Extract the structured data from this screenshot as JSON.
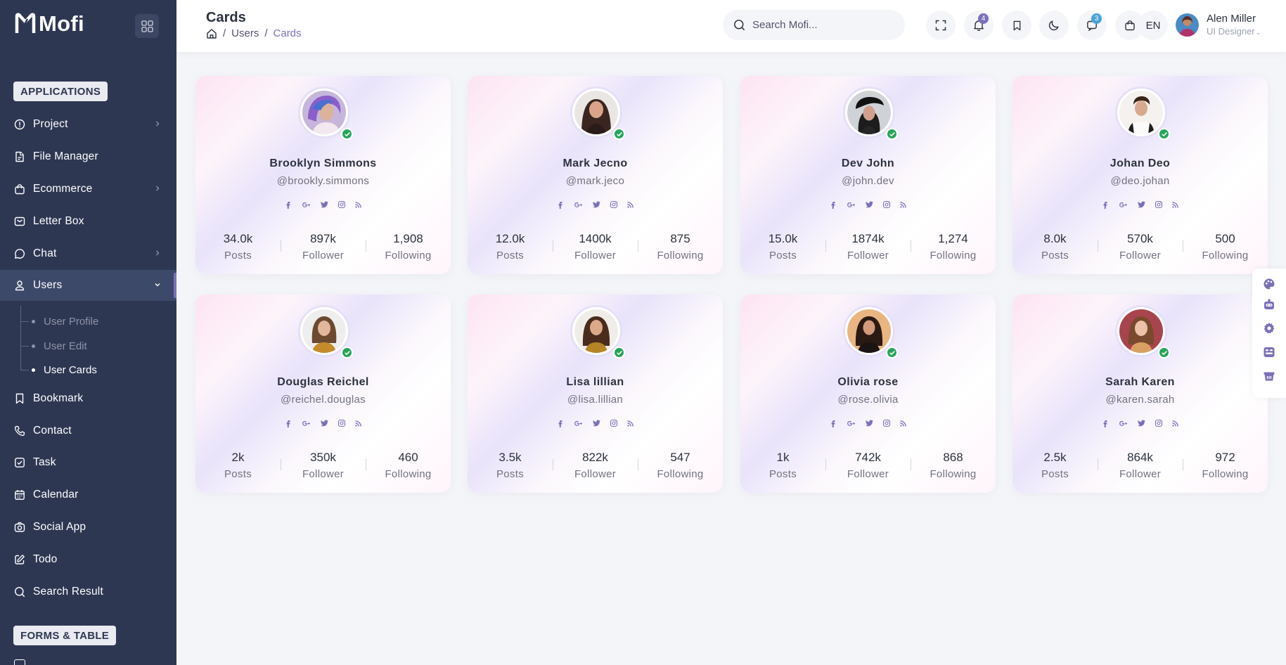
{
  "app": {
    "name": "Mofi"
  },
  "sidebar": {
    "sections": {
      "applications": "APPLICATIONS",
      "forms": "FORMS & TABLE"
    },
    "items": [
      {
        "label": "Project"
      },
      {
        "label": "File Manager"
      },
      {
        "label": "Ecommerce"
      },
      {
        "label": "Letter Box"
      },
      {
        "label": "Chat"
      },
      {
        "label": "Users"
      },
      {
        "label": "Bookmark"
      },
      {
        "label": "Contact"
      },
      {
        "label": "Task"
      },
      {
        "label": "Calendar"
      },
      {
        "label": "Social App"
      },
      {
        "label": "Todo"
      },
      {
        "label": "Search Result"
      }
    ],
    "subitems": [
      {
        "label": "User Profile"
      },
      {
        "label": "User Edit"
      },
      {
        "label": "User Cards"
      }
    ]
  },
  "header": {
    "title": "Cards",
    "breadcrumb": {
      "level1": "Users",
      "current": "Cards"
    },
    "search_placeholder": "Search Mofi...",
    "notifications_count": "4",
    "messages_count": "3",
    "language": "EN",
    "user": {
      "name": "Alen Miller",
      "role": "UI Designer"
    }
  },
  "colors": {
    "accent": "#7a70ba",
    "sidebar": "#2e3752",
    "verified": "#26a65b",
    "badge_blue": "#48a3d7"
  },
  "stat_labels": {
    "posts": "Posts",
    "follower": "Follower",
    "following": "Following"
  },
  "cards": [
    {
      "name": "Brooklyn Simmons",
      "handle": "@brookly.simmons",
      "posts": "34.0k",
      "follower": "897k",
      "following": "1,908"
    },
    {
      "name": "Mark Jecno",
      "handle": "@mark.jeco",
      "posts": "12.0k",
      "follower": "1400k",
      "following": "875"
    },
    {
      "name": "Dev John",
      "handle": "@john.dev",
      "posts": "15.0k",
      "follower": "1874k",
      "following": "1,274"
    },
    {
      "name": "Johan Deo",
      "handle": "@deo.johan",
      "posts": "8.0k",
      "follower": "570k",
      "following": "500"
    },
    {
      "name": "Douglas Reichel",
      "handle": "@reichel.douglas",
      "posts": "2k",
      "follower": "350k",
      "following": "460"
    },
    {
      "name": "Lisa lillian",
      "handle": "@lisa.lillian",
      "posts": "3.5k",
      "follower": "822k",
      "following": "547"
    },
    {
      "name": "Olivia rose",
      "handle": "@rose.olivia",
      "posts": "1k",
      "follower": "742k",
      "following": "868"
    },
    {
      "name": "Sarah Karen",
      "handle": "@karen.sarah",
      "posts": "2.5k",
      "follower": "864k",
      "following": "972"
    }
  ]
}
